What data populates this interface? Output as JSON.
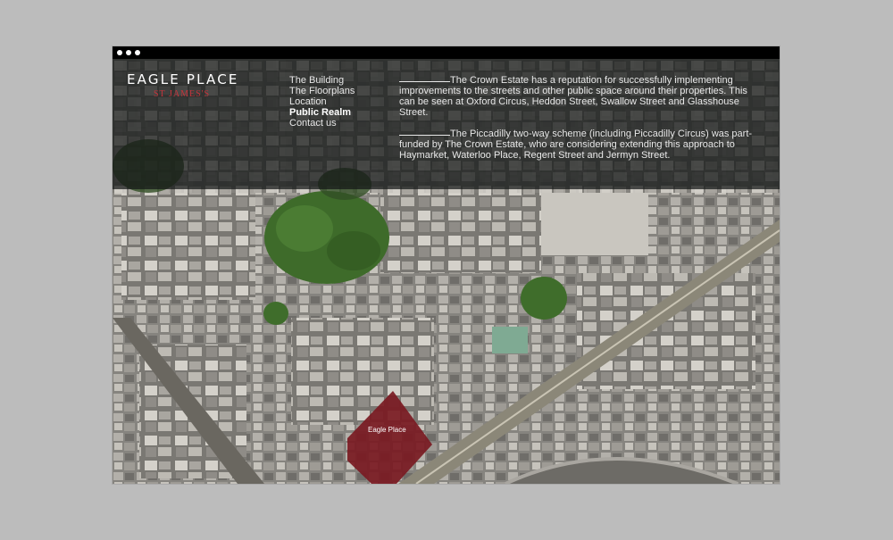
{
  "window": {
    "controls": [
      "dot-1",
      "dot-2",
      "dot-3"
    ]
  },
  "logo": {
    "title": "EAGLE PLACE",
    "subtitle": "ST JAMES'S"
  },
  "nav": {
    "items": [
      {
        "label": "The Building",
        "active": false
      },
      {
        "label": "The Floorplans",
        "active": false
      },
      {
        "label": "Location",
        "active": false
      },
      {
        "label": "Public Realm",
        "active": true
      },
      {
        "label": "Contact us",
        "active": false
      }
    ]
  },
  "content": {
    "paragraphs": [
      "The Crown Estate has a reputation for successfully implementing improvements to the streets and other public space around their properties. This can be seen at Oxford Circus, Heddon Street, Swallow Street and Glasshouse Street.",
      "The Piccadilly two-way scheme (including Piccadilly Circus) was part-funded by The Crown Estate, who are considering extending this approach to Haymarket, Waterloo Place, Regent Street and Jermyn Street."
    ]
  },
  "map": {
    "highlight_label": "Eagle Place",
    "colors": {
      "highlight": "#7a1a22",
      "park": "#3e6b2a",
      "road": "#8b8778",
      "buildings": "#9a9894"
    }
  }
}
